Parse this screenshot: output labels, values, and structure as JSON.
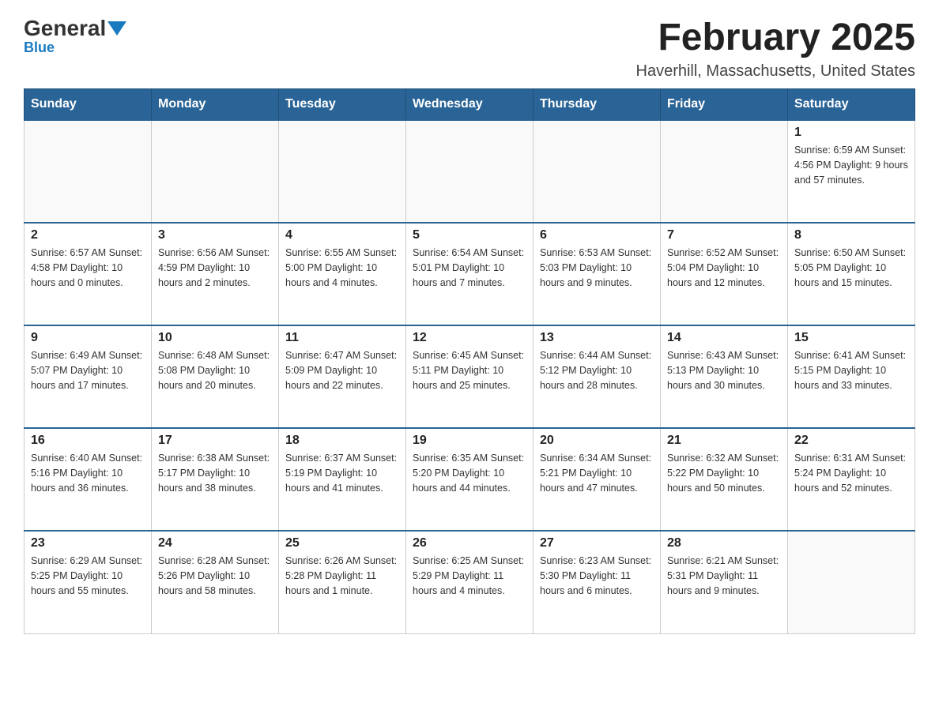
{
  "logo": {
    "general": "General",
    "blue": "Blue"
  },
  "title": "February 2025",
  "subtitle": "Haverhill, Massachusetts, United States",
  "weekdays": [
    "Sunday",
    "Monday",
    "Tuesday",
    "Wednesday",
    "Thursday",
    "Friday",
    "Saturday"
  ],
  "weeks": [
    [
      {
        "day": "",
        "info": ""
      },
      {
        "day": "",
        "info": ""
      },
      {
        "day": "",
        "info": ""
      },
      {
        "day": "",
        "info": ""
      },
      {
        "day": "",
        "info": ""
      },
      {
        "day": "",
        "info": ""
      },
      {
        "day": "1",
        "info": "Sunrise: 6:59 AM\nSunset: 4:56 PM\nDaylight: 9 hours\nand 57 minutes."
      }
    ],
    [
      {
        "day": "2",
        "info": "Sunrise: 6:57 AM\nSunset: 4:58 PM\nDaylight: 10 hours\nand 0 minutes."
      },
      {
        "day": "3",
        "info": "Sunrise: 6:56 AM\nSunset: 4:59 PM\nDaylight: 10 hours\nand 2 minutes."
      },
      {
        "day": "4",
        "info": "Sunrise: 6:55 AM\nSunset: 5:00 PM\nDaylight: 10 hours\nand 4 minutes."
      },
      {
        "day": "5",
        "info": "Sunrise: 6:54 AM\nSunset: 5:01 PM\nDaylight: 10 hours\nand 7 minutes."
      },
      {
        "day": "6",
        "info": "Sunrise: 6:53 AM\nSunset: 5:03 PM\nDaylight: 10 hours\nand 9 minutes."
      },
      {
        "day": "7",
        "info": "Sunrise: 6:52 AM\nSunset: 5:04 PM\nDaylight: 10 hours\nand 12 minutes."
      },
      {
        "day": "8",
        "info": "Sunrise: 6:50 AM\nSunset: 5:05 PM\nDaylight: 10 hours\nand 15 minutes."
      }
    ],
    [
      {
        "day": "9",
        "info": "Sunrise: 6:49 AM\nSunset: 5:07 PM\nDaylight: 10 hours\nand 17 minutes."
      },
      {
        "day": "10",
        "info": "Sunrise: 6:48 AM\nSunset: 5:08 PM\nDaylight: 10 hours\nand 20 minutes."
      },
      {
        "day": "11",
        "info": "Sunrise: 6:47 AM\nSunset: 5:09 PM\nDaylight: 10 hours\nand 22 minutes."
      },
      {
        "day": "12",
        "info": "Sunrise: 6:45 AM\nSunset: 5:11 PM\nDaylight: 10 hours\nand 25 minutes."
      },
      {
        "day": "13",
        "info": "Sunrise: 6:44 AM\nSunset: 5:12 PM\nDaylight: 10 hours\nand 28 minutes."
      },
      {
        "day": "14",
        "info": "Sunrise: 6:43 AM\nSunset: 5:13 PM\nDaylight: 10 hours\nand 30 minutes."
      },
      {
        "day": "15",
        "info": "Sunrise: 6:41 AM\nSunset: 5:15 PM\nDaylight: 10 hours\nand 33 minutes."
      }
    ],
    [
      {
        "day": "16",
        "info": "Sunrise: 6:40 AM\nSunset: 5:16 PM\nDaylight: 10 hours\nand 36 minutes."
      },
      {
        "day": "17",
        "info": "Sunrise: 6:38 AM\nSunset: 5:17 PM\nDaylight: 10 hours\nand 38 minutes."
      },
      {
        "day": "18",
        "info": "Sunrise: 6:37 AM\nSunset: 5:19 PM\nDaylight: 10 hours\nand 41 minutes."
      },
      {
        "day": "19",
        "info": "Sunrise: 6:35 AM\nSunset: 5:20 PM\nDaylight: 10 hours\nand 44 minutes."
      },
      {
        "day": "20",
        "info": "Sunrise: 6:34 AM\nSunset: 5:21 PM\nDaylight: 10 hours\nand 47 minutes."
      },
      {
        "day": "21",
        "info": "Sunrise: 6:32 AM\nSunset: 5:22 PM\nDaylight: 10 hours\nand 50 minutes."
      },
      {
        "day": "22",
        "info": "Sunrise: 6:31 AM\nSunset: 5:24 PM\nDaylight: 10 hours\nand 52 minutes."
      }
    ],
    [
      {
        "day": "23",
        "info": "Sunrise: 6:29 AM\nSunset: 5:25 PM\nDaylight: 10 hours\nand 55 minutes."
      },
      {
        "day": "24",
        "info": "Sunrise: 6:28 AM\nSunset: 5:26 PM\nDaylight: 10 hours\nand 58 minutes."
      },
      {
        "day": "25",
        "info": "Sunrise: 6:26 AM\nSunset: 5:28 PM\nDaylight: 11 hours\nand 1 minute."
      },
      {
        "day": "26",
        "info": "Sunrise: 6:25 AM\nSunset: 5:29 PM\nDaylight: 11 hours\nand 4 minutes."
      },
      {
        "day": "27",
        "info": "Sunrise: 6:23 AM\nSunset: 5:30 PM\nDaylight: 11 hours\nand 6 minutes."
      },
      {
        "day": "28",
        "info": "Sunrise: 6:21 AM\nSunset: 5:31 PM\nDaylight: 11 hours\nand 9 minutes."
      },
      {
        "day": "",
        "info": ""
      }
    ]
  ]
}
